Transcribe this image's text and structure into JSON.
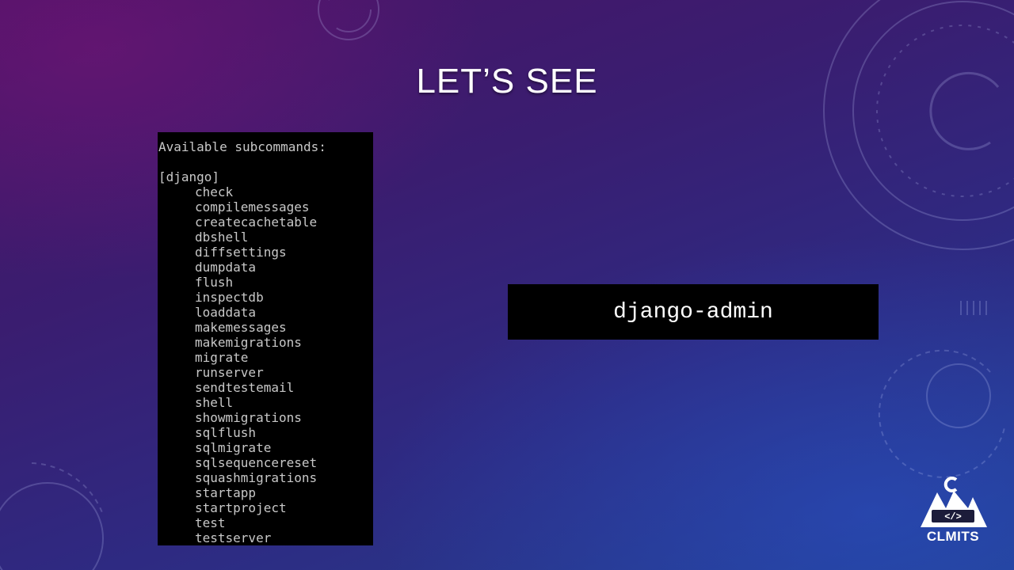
{
  "slide": {
    "title": "LET’S SEE"
  },
  "terminal": {
    "header": "Available subcommands:",
    "group": "[django]",
    "commands": [
      "check",
      "compilemessages",
      "createcachetable",
      "dbshell",
      "diffsettings",
      "dumpdata",
      "flush",
      "inspectdb",
      "loaddata",
      "makemessages",
      "makemigrations",
      "migrate",
      "runserver",
      "sendtestemail",
      "shell",
      "showmigrations",
      "sqlflush",
      "sqlmigrate",
      "sqlsequencereset",
      "squashmigrations",
      "startapp",
      "startproject",
      "test",
      "testserver"
    ]
  },
  "command_box": {
    "text": "django-admin"
  },
  "logo": {
    "text": "CLMITS",
    "icon": "code-mountains-icon"
  },
  "colors": {
    "background_top": "#4a1466",
    "background_bottom": "#23408f",
    "terminal_bg": "#000000",
    "terminal_text": "#c8c8c8",
    "title_text": "#ffffff"
  }
}
